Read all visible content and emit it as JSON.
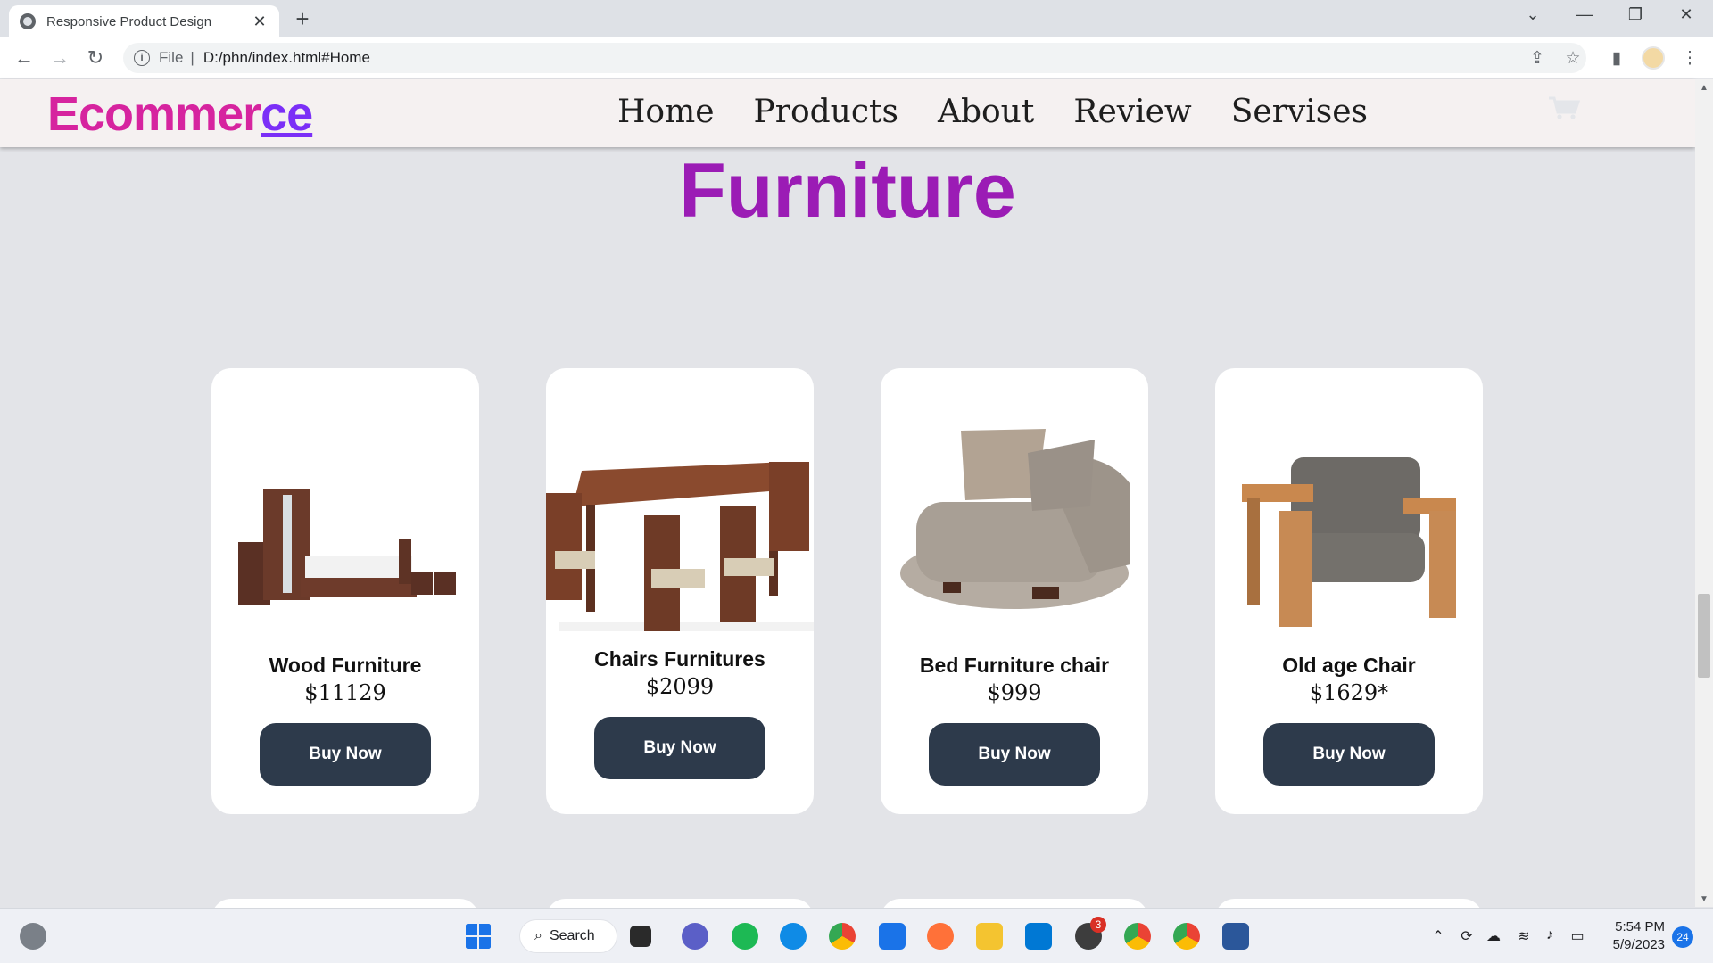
{
  "browser": {
    "tab_title": "Responsive Product Design",
    "tab_close": "✕",
    "new_tab": "+",
    "url_scheme": "File",
    "url_sep": "|",
    "url": "D:/phn/index.html#Home"
  },
  "site": {
    "logo_main": "Ecommer",
    "logo_tail": "ce",
    "nav": [
      "Home",
      "Products",
      "About",
      "Review",
      "Servises"
    ],
    "section_title": "Furniture"
  },
  "products": [
    {
      "name": "Wood Furniture",
      "price": "$11129",
      "button": "Buy Now"
    },
    {
      "name": "Chairs Furnitures",
      "price": "$2099",
      "button": "Buy Now"
    },
    {
      "name": "Bed Furniture chair",
      "price": "$999",
      "button": "Buy Now"
    },
    {
      "name": "Old age Chair",
      "price": "$1629*",
      "button": "Buy Now"
    }
  ],
  "taskbar": {
    "search_label": "Search",
    "time": "5:54 PM",
    "date": "5/9/2023",
    "notification_count": "24",
    "whatsapp_badge": "3"
  },
  "colors": {
    "logo_pink": "#d6249f",
    "logo_purple": "#7b2ff7",
    "title_purple": "#9b1cb5",
    "button_navy": "#2d3a4b"
  }
}
